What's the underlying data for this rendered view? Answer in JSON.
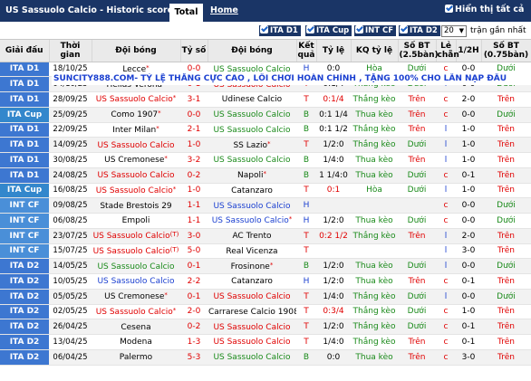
{
  "header": {
    "title": "US Sassuolo Calcio - Historic scores",
    "tab_total": "Total",
    "tab_home": "Home",
    "show_all": "Hiển thị tất cả"
  },
  "filters": {
    "items": [
      "ITA D1",
      "ITA Cup",
      "INT CF",
      "ITA D2"
    ],
    "count_value": "20",
    "recent_label": "trận gần nhất"
  },
  "columns": [
    "Giải đấu",
    "Thời gian",
    "Đội bóng",
    "Tỷ số",
    "Đội bóng",
    "Kết quả",
    "Tỷ lệ",
    "KQ tỷ lệ",
    "Số BT (2.5bàn)",
    "Lẻ chẵn",
    "1/2H",
    "Số BT (0.75bàn)"
  ],
  "promo_text": "SUNCITY888.COM- TỶ LỆ THẮNG CỰC CAO , LỐI CHƠI HOÀN CHỈNH , TẶNG 100% CHO LẦN NẠP ĐẦU",
  "rows": [
    {
      "league": "ITA D1",
      "date": "18/10/25",
      "home": "Lecce",
      "home_mark": "*",
      "home_color": "dark",
      "score": "0-0",
      "away": "US Sassuolo Calcio",
      "away_mark": "",
      "away_color": "green",
      "res": "H",
      "res_color": "blue",
      "hc": "0:0",
      "hc_color": "dark",
      "hcres": "Hòa",
      "hcres_color": "green",
      "ou": "Dưới",
      "ou_color": "green",
      "oe": "c",
      "oe_color": "red",
      "half": "0-0",
      "ou2": "Dưới",
      "ou2_color": "green"
    },
    {
      "league": "ITA D1",
      "date": "04/10/25",
      "home": "Hellas Verona",
      "home_mark": "*",
      "home_color": "dark",
      "score": "0-1",
      "away": "US Sassuolo Calcio",
      "away_mark": "",
      "away_color": "red",
      "res": "T",
      "res_color": "red",
      "hc": "0:1/4",
      "hc_color": "dark",
      "hcres": "Thắng kèo",
      "hcres_color": "green",
      "ou": "Dưới",
      "ou_color": "green",
      "oe": "l",
      "oe_color": "blue",
      "half": "0-0",
      "ou2": "Dưới",
      "ou2_color": "green"
    },
    {
      "league": "ITA D1",
      "date": "28/09/25",
      "home": "US Sassuolo Calcio",
      "home_mark": "*",
      "home_color": "red",
      "score": "3-1",
      "away": "Udinese Calcio",
      "away_mark": "",
      "away_color": "dark",
      "res": "T",
      "res_color": "red",
      "hc": "0:1/4",
      "hc_color": "red",
      "hcres": "Thắng kèo",
      "hcres_color": "green",
      "ou": "Trên",
      "ou_color": "red",
      "oe": "c",
      "oe_color": "red",
      "half": "2-0",
      "ou2": "Trên",
      "ou2_color": "red"
    },
    {
      "league": "ITA Cup",
      "date": "25/09/25",
      "home": "Como 1907",
      "home_mark": "*",
      "home_color": "dark",
      "score": "0-0",
      "away": "US Sassuolo Calcio",
      "away_mark": "",
      "away_color": "green",
      "res": "B",
      "res_color": "green",
      "hc": "0:1 1/4",
      "hc_color": "dark",
      "hcres": "Thua kèo",
      "hcres_color": "green",
      "ou": "Trên",
      "ou_color": "red",
      "oe": "c",
      "oe_color": "red",
      "half": "0-0",
      "ou2": "Dưới",
      "ou2_color": "green"
    },
    {
      "league": "ITA D1",
      "date": "22/09/25",
      "home": "Inter Milan",
      "home_mark": "*",
      "home_color": "dark",
      "score": "2-1",
      "away": "US Sassuolo Calcio",
      "away_mark": "",
      "away_color": "green",
      "res": "B",
      "res_color": "green",
      "hc": "0:1 1/2",
      "hc_color": "dark",
      "hcres": "Thắng kèo",
      "hcres_color": "green",
      "ou": "Trên",
      "ou_color": "red",
      "oe": "l",
      "oe_color": "blue",
      "half": "1-0",
      "ou2": "Trên",
      "ou2_color": "red"
    },
    {
      "league": "ITA D1",
      "date": "14/09/25",
      "home": "US Sassuolo Calcio",
      "home_mark": "",
      "home_color": "red",
      "score": "1-0",
      "away": "SS Lazio",
      "away_mark": "*",
      "away_color": "dark",
      "res": "T",
      "res_color": "red",
      "hc": "1/2:0",
      "hc_color": "dark",
      "hcres": "Thắng kèo",
      "hcres_color": "green",
      "ou": "Dưới",
      "ou_color": "green",
      "oe": "l",
      "oe_color": "blue",
      "half": "1-0",
      "ou2": "Trên",
      "ou2_color": "red"
    },
    {
      "league": "ITA D1",
      "date": "30/08/25",
      "home": "US Cremonese",
      "home_mark": "*",
      "home_color": "dark",
      "score": "3-2",
      "away": "US Sassuolo Calcio",
      "away_mark": "",
      "away_color": "green",
      "res": "B",
      "res_color": "green",
      "hc": "1/4:0",
      "hc_color": "dark",
      "hcres": "Thua kèo",
      "hcres_color": "green",
      "ou": "Trên",
      "ou_color": "red",
      "oe": "l",
      "oe_color": "blue",
      "half": "1-0",
      "ou2": "Trên",
      "ou2_color": "red"
    },
    {
      "league": "ITA D1",
      "date": "24/08/25",
      "home": "US Sassuolo Calcio",
      "home_mark": "",
      "home_color": "red",
      "score": "0-2",
      "away": "Napoli",
      "away_mark": "*",
      "away_color": "dark",
      "res": "B",
      "res_color": "green",
      "hc": "1 1/4:0",
      "hc_color": "dark",
      "hcres": "Thua kèo",
      "hcres_color": "green",
      "ou": "Dưới",
      "ou_color": "green",
      "oe": "c",
      "oe_color": "red",
      "half": "0-1",
      "ou2": "Trên",
      "ou2_color": "red"
    },
    {
      "league": "ITA Cup",
      "date": "16/08/25",
      "home": "US Sassuolo Calcio",
      "home_mark": "*",
      "home_color": "red",
      "score": "1-0",
      "away": "Catanzaro",
      "away_mark": "",
      "away_color": "dark",
      "res": "T",
      "res_color": "red",
      "hc": "0:1",
      "hc_color": "red",
      "hcres": "Hòa",
      "hcres_color": "green",
      "ou": "Dưới",
      "ou_color": "green",
      "oe": "l",
      "oe_color": "blue",
      "half": "1-0",
      "ou2": "Trên",
      "ou2_color": "red"
    },
    {
      "league": "INT CF",
      "date": "09/08/25",
      "home": "Stade Brestois 29",
      "home_mark": "",
      "home_color": "dark",
      "score": "1-1",
      "away": "US Sassuolo Calcio",
      "away_mark": "",
      "away_color": "blue",
      "res": "H",
      "res_color": "blue",
      "hc": "",
      "hc_color": "dark",
      "hcres": "",
      "hcres_color": "green",
      "ou": "",
      "ou_color": "green",
      "oe": "c",
      "oe_color": "red",
      "half": "0-0",
      "ou2": "Dưới",
      "ou2_color": "green"
    },
    {
      "league": "INT CF",
      "date": "06/08/25",
      "home": "Empoli",
      "home_mark": "",
      "home_color": "dark",
      "score": "1-1",
      "away": "US Sassuolo Calcio",
      "away_mark": "*",
      "away_color": "blue",
      "res": "H",
      "res_color": "blue",
      "hc": "1/2:0",
      "hc_color": "dark",
      "hcres": "Thua kèo",
      "hcres_color": "green",
      "ou": "Dưới",
      "ou_color": "green",
      "oe": "c",
      "oe_color": "red",
      "half": "0-0",
      "ou2": "Dưới",
      "ou2_color": "green"
    },
    {
      "league": "INT CF",
      "date": "23/07/25",
      "home": "US Sassuolo Calcio",
      "home_mark": "(T)",
      "home_color": "red",
      "score": "3-0",
      "away": "AC Trento",
      "away_mark": "",
      "away_color": "dark",
      "res": "T",
      "res_color": "red",
      "hc": "0:2 1/2",
      "hc_color": "red",
      "hcres": "Thắng kèo",
      "hcres_color": "green",
      "ou": "Trên",
      "ou_color": "red",
      "oe": "l",
      "oe_color": "blue",
      "half": "2-0",
      "ou2": "Trên",
      "ou2_color": "red"
    },
    {
      "league": "INT CF",
      "date": "15/07/25",
      "home": "US Sassuolo Calcio",
      "home_mark": "(T)",
      "home_color": "red",
      "score": "5-0",
      "away": "Real Vicenza",
      "away_mark": "",
      "away_color": "dark",
      "res": "T",
      "res_color": "red",
      "hc": "",
      "hc_color": "dark",
      "hcres": "",
      "hcres_color": "green",
      "ou": "",
      "ou_color": "green",
      "oe": "l",
      "oe_color": "blue",
      "half": "3-0",
      "ou2": "Trên",
      "ou2_color": "red"
    },
    {
      "league": "ITA D2",
      "date": "14/05/25",
      "home": "US Sassuolo Calcio",
      "home_mark": "",
      "home_color": "green",
      "score": "0-1",
      "away": "Frosinone",
      "away_mark": "*",
      "away_color": "dark",
      "res": "B",
      "res_color": "green",
      "hc": "1/2:0",
      "hc_color": "dark",
      "hcres": "Thua kèo",
      "hcres_color": "green",
      "ou": "Dưới",
      "ou_color": "green",
      "oe": "l",
      "oe_color": "blue",
      "half": "0-0",
      "ou2": "Dưới",
      "ou2_color": "green"
    },
    {
      "league": "ITA D2",
      "date": "10/05/25",
      "home": "US Sassuolo Calcio",
      "home_mark": "",
      "home_color": "blue",
      "score": "2-2",
      "away": "Catanzaro",
      "away_mark": "",
      "away_color": "dark",
      "res": "H",
      "res_color": "blue",
      "hc": "1/2:0",
      "hc_color": "dark",
      "hcres": "Thua kèo",
      "hcres_color": "green",
      "ou": "Trên",
      "ou_color": "red",
      "oe": "c",
      "oe_color": "red",
      "half": "0-1",
      "ou2": "Trên",
      "ou2_color": "red"
    },
    {
      "league": "ITA D2",
      "date": "05/05/25",
      "home": "US Cremonese",
      "home_mark": "*",
      "home_color": "dark",
      "score": "0-1",
      "away": "US Sassuolo Calcio",
      "away_mark": "",
      "away_color": "red",
      "res": "T",
      "res_color": "red",
      "hc": "1/4:0",
      "hc_color": "dark",
      "hcres": "Thắng kèo",
      "hcres_color": "green",
      "ou": "Dưới",
      "ou_color": "green",
      "oe": "l",
      "oe_color": "blue",
      "half": "0-0",
      "ou2": "Dưới",
      "ou2_color": "green"
    },
    {
      "league": "ITA D2",
      "date": "02/05/25",
      "home": "US Sassuolo Calcio",
      "home_mark": "*",
      "home_color": "red",
      "score": "2-0",
      "away": "Carrarese Calcio 1908",
      "away_mark": "",
      "away_color": "dark",
      "res": "T",
      "res_color": "red",
      "hc": "0:3/4",
      "hc_color": "red",
      "hcres": "Thắng kèo",
      "hcres_color": "green",
      "ou": "Dưới",
      "ou_color": "green",
      "oe": "c",
      "oe_color": "red",
      "half": "1-0",
      "ou2": "Trên",
      "ou2_color": "red"
    },
    {
      "league": "ITA D2",
      "date": "26/04/25",
      "home": "Cesena",
      "home_mark": "",
      "home_color": "dark",
      "score": "0-2",
      "away": "US Sassuolo Calcio",
      "away_mark": "",
      "away_color": "red",
      "res": "T",
      "res_color": "red",
      "hc": "1/2:0",
      "hc_color": "dark",
      "hcres": "Thắng kèo",
      "hcres_color": "green",
      "ou": "Dưới",
      "ou_color": "green",
      "oe": "c",
      "oe_color": "red",
      "half": "0-1",
      "ou2": "Trên",
      "ou2_color": "red"
    },
    {
      "league": "ITA D2",
      "date": "13/04/25",
      "home": "Modena",
      "home_mark": "",
      "home_color": "dark",
      "score": "1-3",
      "away": "US Sassuolo Calcio",
      "away_mark": "",
      "away_color": "red",
      "res": "T",
      "res_color": "red",
      "hc": "1/4:0",
      "hc_color": "dark",
      "hcres": "Thắng kèo",
      "hcres_color": "green",
      "ou": "Trên",
      "ou_color": "red",
      "oe": "c",
      "oe_color": "red",
      "half": "0-1",
      "ou2": "Trên",
      "ou2_color": "red"
    },
    {
      "league": "ITA D2",
      "date": "06/04/25",
      "home": "Palermo",
      "home_mark": "",
      "home_color": "dark",
      "score": "5-3",
      "away": "US Sassuolo Calcio",
      "away_mark": "",
      "away_color": "green",
      "res": "B",
      "res_color": "green",
      "hc": "0:0",
      "hc_color": "dark",
      "hcres": "Thua kèo",
      "hcres_color": "green",
      "ou": "Trên",
      "ou_color": "red",
      "oe": "c",
      "oe_color": "red",
      "half": "3-0",
      "ou2": "Trên",
      "ou2_color": "red"
    }
  ],
  "colors": {
    "header_bg": "#1a3566",
    "league_bg": "#3d77d1",
    "win": "#e00000",
    "loss": "#1a8a1a",
    "draw": "#1a3fd0"
  }
}
